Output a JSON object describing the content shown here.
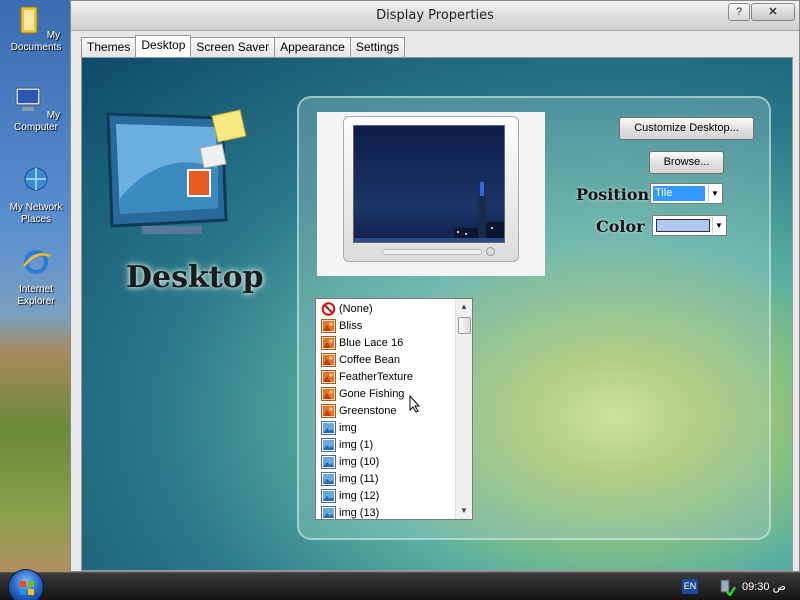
{
  "desktop": {
    "icons": [
      {
        "label": "My Documents",
        "icon": "folder-icon"
      },
      {
        "label": "My Computer",
        "icon": "computer-icon"
      },
      {
        "label": "My Network Places",
        "icon": "network-icon"
      },
      {
        "label": "Internet Explorer",
        "icon": "ie-icon"
      }
    ]
  },
  "window": {
    "title": "Display Properties",
    "help_label": "?",
    "close_label": "✕",
    "tabs": [
      {
        "label": "Themes",
        "active": false
      },
      {
        "label": "Desktop",
        "active": true
      },
      {
        "label": "Screen Saver",
        "active": false
      },
      {
        "label": "Appearance",
        "active": false
      },
      {
        "label": "Settings",
        "active": false
      }
    ]
  },
  "desktop_tab": {
    "heading": "Desktop",
    "customize_label": "Customize Desktop...",
    "browse_label": "Browse...",
    "position_label": "Position :",
    "position_value": "Tile",
    "color_label": "Color :",
    "color_value": "#b0c8f0",
    "wallpapers": [
      {
        "label": "(None)",
        "icon": "none-icon"
      },
      {
        "label": "Bliss",
        "icon": "picture-icon"
      },
      {
        "label": "Blue Lace 16",
        "icon": "picture-icon"
      },
      {
        "label": "Coffee Bean",
        "icon": "picture-icon"
      },
      {
        "label": "FeatherTexture",
        "icon": "picture-icon"
      },
      {
        "label": "Gone Fishing",
        "icon": "picture-icon"
      },
      {
        "label": "Greenstone",
        "icon": "picture-icon"
      },
      {
        "label": "img",
        "icon": "image-file-icon"
      },
      {
        "label": "img (1)",
        "icon": "image-file-icon"
      },
      {
        "label": "img (10)",
        "icon": "image-file-icon"
      },
      {
        "label": "img (11)",
        "icon": "image-file-icon"
      },
      {
        "label": "img (12)",
        "icon": "image-file-icon"
      },
      {
        "label": "img (13)",
        "icon": "image-file-icon"
      }
    ]
  },
  "taskbar": {
    "language": "EN",
    "clock": "09:30 ص"
  },
  "colors": {
    "selection": "#3399ff",
    "pane_accent": "#2a7a8a"
  }
}
